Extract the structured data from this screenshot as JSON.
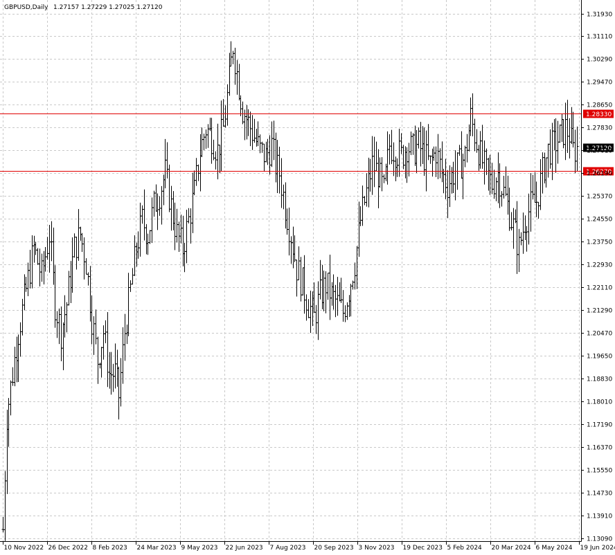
{
  "header": {
    "symbol_timeframe": "GBPUSD,Daily",
    "ohlc": "1.27157 1.27229 1.27025 1.27120"
  },
  "colors": {
    "background": "#ffffff",
    "bars": "#000000",
    "grid": "#c8c8c8",
    "level_line": "#e00000",
    "price_marker_bg": "#000000"
  },
  "chart_data": {
    "type": "ohlc-bar",
    "symbol": "GBPUSD",
    "timeframe": "Daily",
    "x_tick_labels": [
      "10 Nov 2022",
      "26 Dec 2022",
      "8 Feb 2023",
      "24 Mar 2023",
      "9 May 2023",
      "22 Jun 2023",
      "7 Aug 2023",
      "20 Sep 2023",
      "3 Nov 2023",
      "19 Dec 2023",
      "5 Feb 2024",
      "20 Mar 2024",
      "6 May 2024",
      "19 Jun 2024"
    ],
    "y_tick_labels": [
      "1.31930",
      "1.31110",
      "1.30290",
      "1.29470",
      "1.28650",
      "1.27830",
      "1.27010",
      "1.26190",
      "1.25370",
      "1.24550",
      "1.23750",
      "1.22930",
      "1.22110",
      "1.21290",
      "1.20470",
      "1.19650",
      "1.18830",
      "1.18010",
      "1.17190",
      "1.16370",
      "1.15550",
      "1.14730",
      "1.13910",
      "1.13090"
    ],
    "y_range": [
      1.1309,
      1.3193
    ],
    "grid": true,
    "horizontal_levels": [
      {
        "value": 1.2833,
        "label": "1.28330"
      },
      {
        "value": 1.2627,
        "label": "1.26270"
      }
    ],
    "last_price": {
      "value": 1.2712,
      "label": "1.27120"
    },
    "price_path": [
      [
        0,
        1.134
      ],
      [
        2,
        1.175
      ],
      [
        5,
        1.19
      ],
      [
        8,
        1.205
      ],
      [
        12,
        1.22
      ],
      [
        16,
        1.235
      ],
      [
        20,
        1.225
      ],
      [
        24,
        1.24
      ],
      [
        27,
        1.215
      ],
      [
        30,
        1.205
      ],
      [
        33,
        1.215
      ],
      [
        37,
        1.235
      ],
      [
        40,
        1.24
      ],
      [
        43,
        1.23
      ],
      [
        46,
        1.21
      ],
      [
        49,
        1.195
      ],
      [
        52,
        1.205
      ],
      [
        55,
        1.19
      ],
      [
        58,
        1.19
      ],
      [
        60,
        1.182
      ],
      [
        63,
        1.205
      ],
      [
        66,
        1.22
      ],
      [
        69,
        1.235
      ],
      [
        72,
        1.245
      ],
      [
        75,
        1.24
      ],
      [
        78,
        1.25
      ],
      [
        81,
        1.255
      ],
      [
        84,
        1.262
      ],
      [
        87,
        1.25
      ],
      [
        90,
        1.24
      ],
      [
        93,
        1.235
      ],
      [
        96,
        1.245
      ],
      [
        99,
        1.255
      ],
      [
        102,
        1.27
      ],
      [
        105,
        1.278
      ],
      [
        108,
        1.275
      ],
      [
        111,
        1.27
      ],
      [
        114,
        1.278
      ],
      [
        117,
        1.295
      ],
      [
        119,
        1.308
      ],
      [
        121,
        1.298
      ],
      [
        124,
        1.285
      ],
      [
        127,
        1.28
      ],
      [
        130,
        1.275
      ],
      [
        133,
        1.27
      ],
      [
        136,
        1.268
      ],
      [
        139,
        1.272
      ],
      [
        141,
        1.265
      ],
      [
        143,
        1.262
      ],
      [
        146,
        1.25
      ],
      [
        149,
        1.24
      ],
      [
        152,
        1.228
      ],
      [
        155,
        1.222
      ],
      [
        158,
        1.215
      ],
      [
        161,
        1.21
      ],
      [
        164,
        1.218
      ],
      [
        167,
        1.222
      ],
      [
        170,
        1.218
      ],
      [
        173,
        1.215
      ],
      [
        176,
        1.212
      ],
      [
        179,
        1.22
      ],
      [
        182,
        1.23
      ],
      [
        185,
        1.245
      ],
      [
        188,
        1.255
      ],
      [
        191,
        1.265
      ],
      [
        194,
        1.262
      ],
      [
        197,
        1.255
      ],
      [
        200,
        1.272
      ],
      [
        203,
        1.27
      ],
      [
        206,
        1.268
      ],
      [
        209,
        1.272
      ],
      [
        212,
        1.27
      ],
      [
        215,
        1.272
      ],
      [
        218,
        1.268
      ],
      [
        221,
        1.265
      ],
      [
        224,
        1.27
      ],
      [
        227,
        1.262
      ],
      [
        230,
        1.258
      ],
      [
        233,
        1.262
      ],
      [
        236,
        1.265
      ],
      [
        239,
        1.268
      ],
      [
        242,
        1.282
      ],
      [
        244,
        1.276
      ],
      [
        247,
        1.268
      ],
      [
        250,
        1.262
      ],
      [
        253,
        1.258
      ],
      [
        256,
        1.262
      ],
      [
        259,
        1.255
      ],
      [
        262,
        1.248
      ],
      [
        265,
        1.24
      ],
      [
        267,
        1.235
      ],
      [
        270,
        1.245
      ],
      [
        273,
        1.25
      ],
      [
        276,
        1.252
      ],
      [
        279,
        1.262
      ],
      [
        282,
        1.27
      ],
      [
        285,
        1.272
      ],
      [
        288,
        1.275
      ],
      [
        291,
        1.278
      ],
      [
        293,
        1.276
      ],
      [
        295,
        1.27
      ],
      [
        297,
        1.271
      ]
    ]
  }
}
